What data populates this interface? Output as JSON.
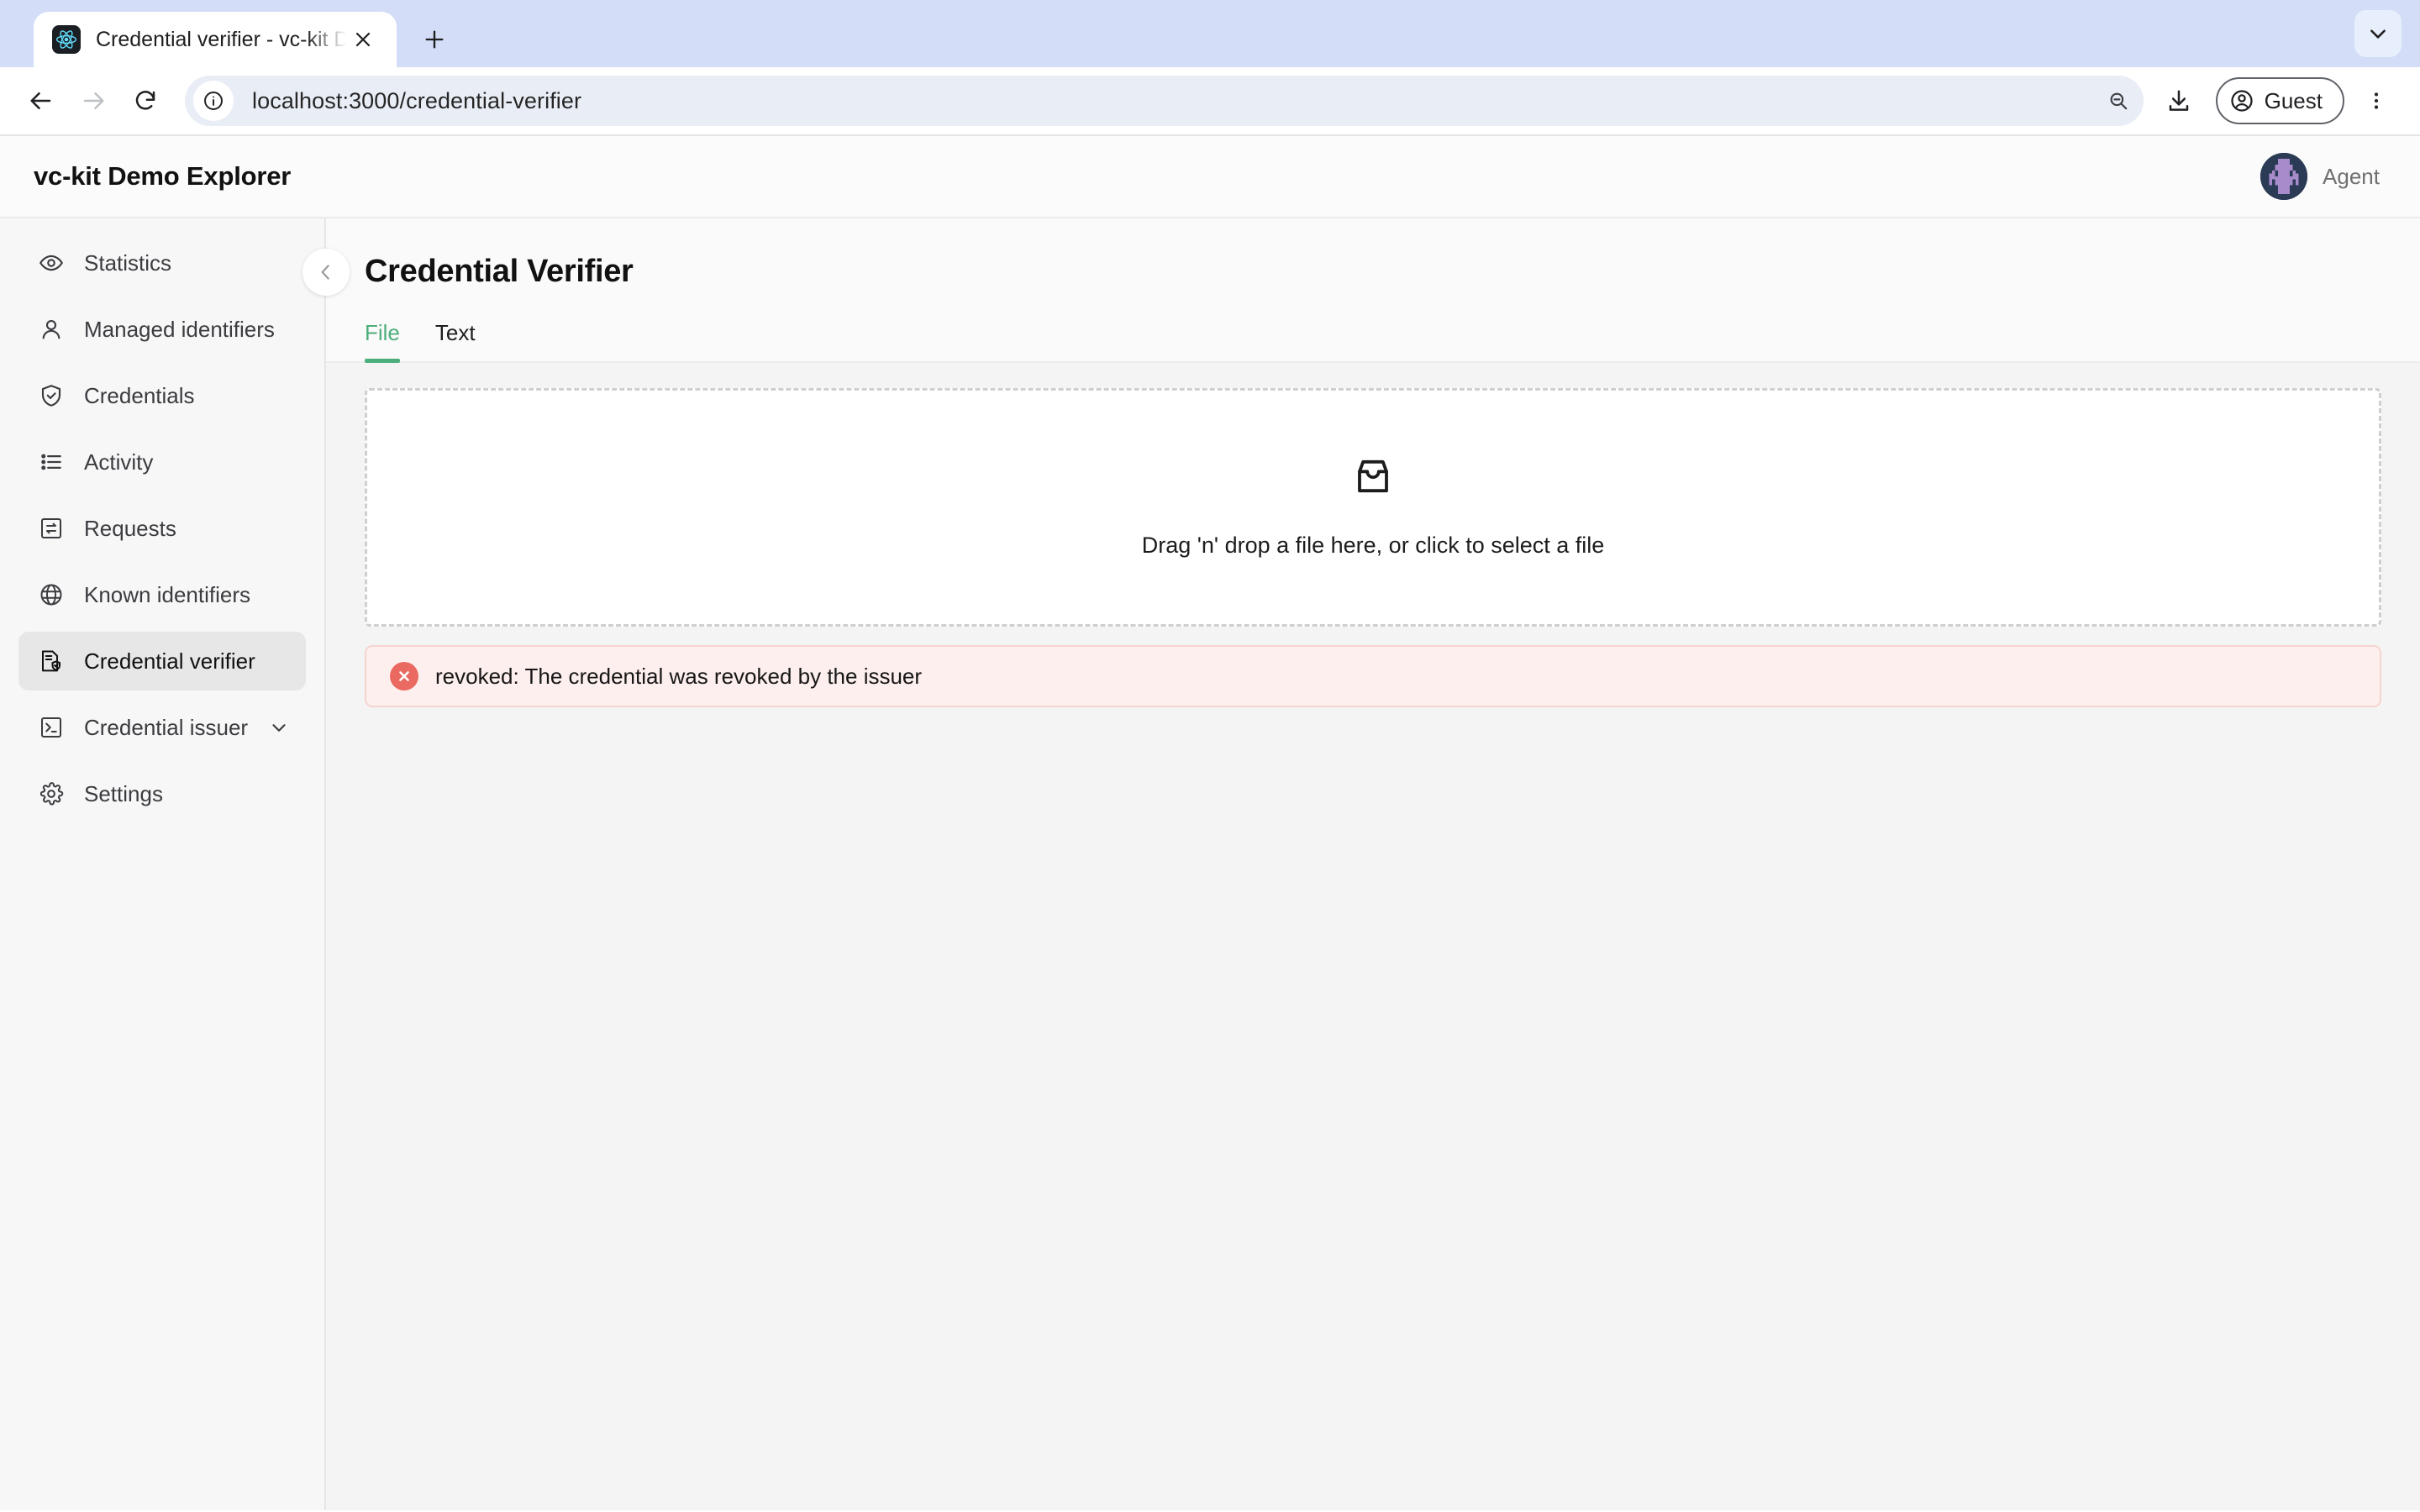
{
  "browser": {
    "tab": {
      "title": "Credential verifier - vc-kit De",
      "favicon_name": "react-atom-icon",
      "close_label": "×",
      "new_tab_label": "+"
    },
    "toolbar": {
      "back_label": "←",
      "forward_label": "→",
      "reload_label": "⟳",
      "url": "localhost:3000/credential-verifier",
      "url_placeholder": "Search Google or type a URL",
      "site_info_icon": "info-circle-icon",
      "zoom_icon": "zoom-out-icon",
      "download_icon": "download-icon",
      "profile_label": "Guest",
      "menu_icon": "three-dot-menu-icon",
      "tabstrip_menu_icon": "chevron-down-icon"
    }
  },
  "app": {
    "title": "vc-kit Demo Explorer",
    "user": {
      "name": "Agent",
      "avatar_name": "agent-pixel-avatar"
    }
  },
  "sidebar": {
    "collapse_icon": "chevron-left-icon",
    "items": [
      {
        "label": "Statistics",
        "icon": "eye-icon",
        "active": false,
        "expandable": false
      },
      {
        "label": "Managed identifiers",
        "icon": "user-icon",
        "active": false,
        "expandable": false
      },
      {
        "label": "Credentials",
        "icon": "shield-check-icon",
        "active": false,
        "expandable": false
      },
      {
        "label": "Activity",
        "icon": "list-icon",
        "active": false,
        "expandable": false
      },
      {
        "label": "Requests",
        "icon": "sync-box-icon",
        "active": false,
        "expandable": false
      },
      {
        "label": "Known identifiers",
        "icon": "globe-icon",
        "active": false,
        "expandable": false
      },
      {
        "label": "Credential verifier",
        "icon": "document-shield-icon",
        "active": true,
        "expandable": false
      },
      {
        "label": "Credential issuer",
        "icon": "terminal-icon",
        "active": false,
        "expandable": true
      },
      {
        "label": "Settings",
        "icon": "gear-icon",
        "active": false,
        "expandable": false
      }
    ]
  },
  "page": {
    "title": "Credential Verifier",
    "tabs": [
      {
        "label": "File",
        "active": true
      },
      {
        "label": "Text",
        "active": false
      }
    ],
    "dropzone": {
      "icon": "inbox-tray-icon",
      "text": "Drag 'n' drop a file here, or click to select a file"
    },
    "alert": {
      "icon": "error-x-icon",
      "text": "revoked: The credential was revoked by the issuer",
      "background": "#fdefed",
      "border": "#f6d4ce",
      "icon_color": "#ea6a62"
    }
  },
  "colors": {
    "accent_green": "#4caf7b",
    "error_red": "#ea6a62",
    "page_background": "#f4f4f5",
    "sidebar_background": "#f7f7f8",
    "active_nav_background": "#e7e7e8"
  }
}
